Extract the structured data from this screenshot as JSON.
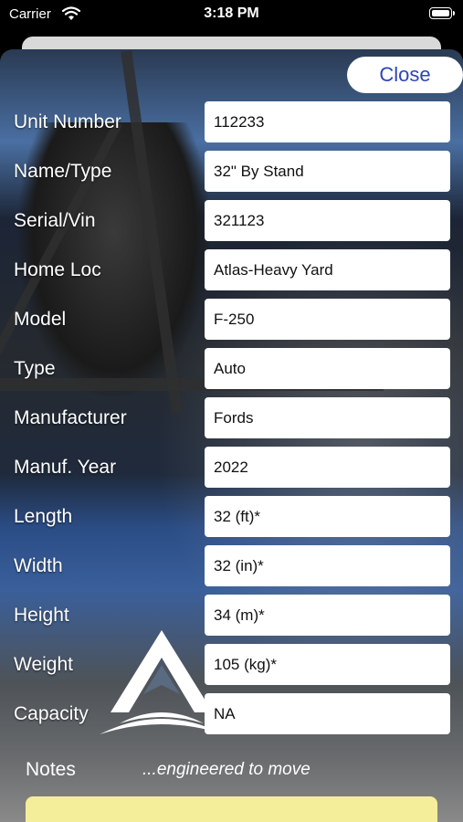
{
  "status_bar": {
    "carrier": "Carrier",
    "time": "3:18 PM",
    "icons": [
      "wifi-icon",
      "battery-icon"
    ]
  },
  "header": {
    "close_label": "Close"
  },
  "fields": [
    {
      "label": "Unit Number",
      "value": "112233"
    },
    {
      "label": "Name/Type",
      "value": "32\" By Stand"
    },
    {
      "label": "Serial/Vin",
      "value": "321123"
    },
    {
      "label": "Home Loc",
      "value": "Atlas-Heavy Yard"
    },
    {
      "label": "Model",
      "value": "F-250"
    },
    {
      "label": "Type",
      "value": "Auto"
    },
    {
      "label": "Manufacturer",
      "value": "Fords"
    },
    {
      "label": "Manuf. Year",
      "value": "2022"
    },
    {
      "label": "Length",
      "value": "32 (ft)*"
    },
    {
      "label": "Width",
      "value": "32 (in)*"
    },
    {
      "label": "Height",
      "value": "34 (m)*"
    },
    {
      "label": "Weight",
      "value": "105 (kg)*"
    },
    {
      "label": "Capacity",
      "value": "NA"
    }
  ],
  "notes": {
    "label": "Notes",
    "tagline": "...engineered to move"
  },
  "colors": {
    "accent": "#2f45b6",
    "notes_field": "#f4ee9a"
  }
}
